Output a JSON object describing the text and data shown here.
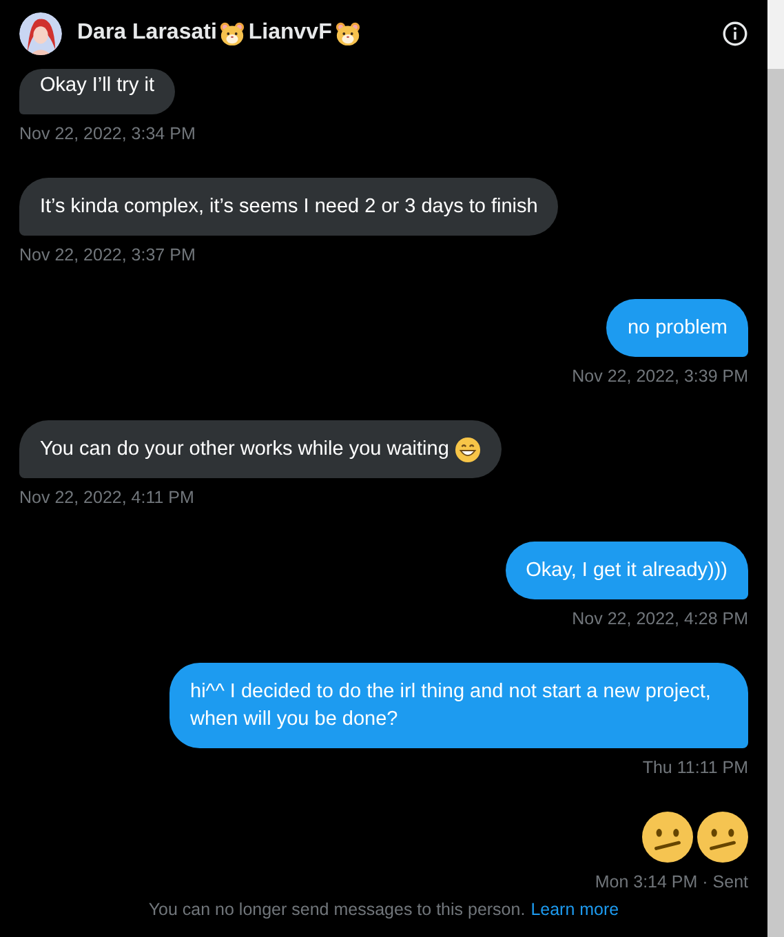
{
  "header": {
    "name": "Dara Larasati",
    "handle": "LianvvF"
  },
  "messages": [
    {
      "kind": "text",
      "mine": false,
      "text": "Okay I’ll try it",
      "emoji": false,
      "time": "Nov 22, 2022, 3:34 PM"
    },
    {
      "kind": "text",
      "mine": false,
      "text": "It’s kinda complex, it’s seems I need 2 or 3 days to finish",
      "emoji": false,
      "time": "Nov 22, 2022, 3:37 PM"
    },
    {
      "kind": "text",
      "mine": true,
      "text": "no problem",
      "emoji": false,
      "time": "Nov 22, 2022, 3:39 PM"
    },
    {
      "kind": "text",
      "mine": false,
      "text": "You can do your other works while you waiting",
      "emoji": true,
      "time": "Nov 22, 2022, 4:11 PM"
    },
    {
      "kind": "text",
      "mine": true,
      "text": "Okay, I get it already)))",
      "emoji": false,
      "time": "Nov 22, 2022, 4:28 PM"
    },
    {
      "kind": "text",
      "mine": true,
      "text": "hi^^ I decided to do the irl thing and not start a new project, when will you be done?",
      "emoji": false,
      "time": "Thu 11:11 PM"
    },
    {
      "kind": "emoji",
      "mine": true,
      "time": "Mon 3:14 PM · Sent"
    }
  ],
  "footer": {
    "notice": "You can no longer send messages to this person.",
    "link": "Learn more"
  }
}
